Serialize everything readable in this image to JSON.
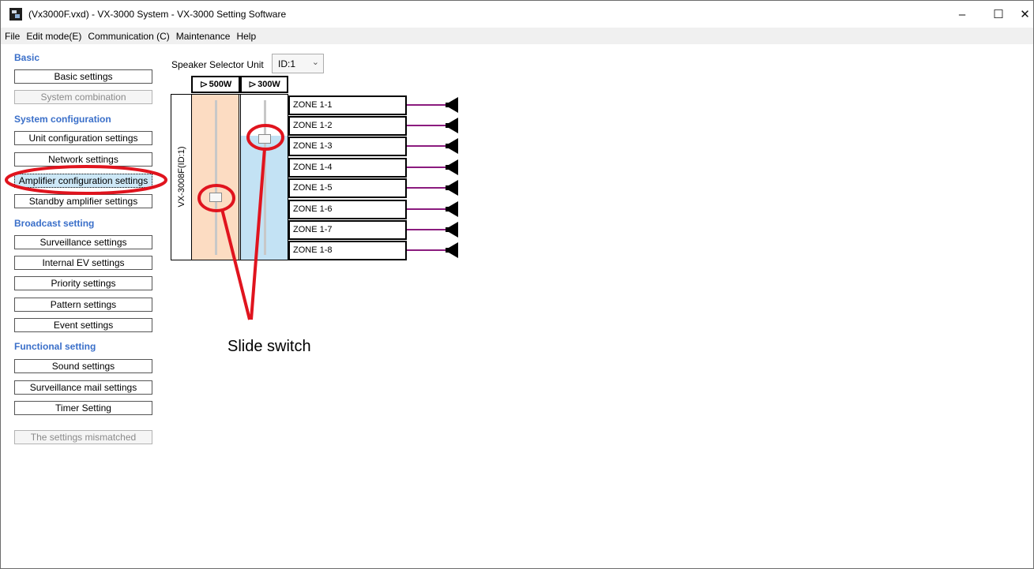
{
  "window": {
    "title": "(Vx3000F.vxd) - VX-3000 System - VX-3000 Setting Software",
    "controls": {
      "minimize": "–",
      "maximize": "☐",
      "close": "✕"
    }
  },
  "menubar": [
    "File",
    "Edit mode(E)",
    "Communication (C)",
    "Maintenance",
    "Help"
  ],
  "sidebar": {
    "categories": {
      "basic": "Basic",
      "system": "System configuration",
      "broadcast": "Broadcast setting",
      "functional": "Functional setting"
    },
    "buttons": {
      "basic_settings": "Basic settings",
      "system_combination": "System combination",
      "unit_configuration": "Unit configuration settings",
      "network": "Network settings",
      "amplifier_configuration": "Amplifier configuration settings",
      "standby_amplifier": "Standby amplifier settings",
      "surveillance": "Surveillance settings",
      "internal_ev": "Internal EV settings",
      "priority": "Priority settings",
      "pattern": "Pattern settings",
      "event": "Event settings",
      "sound": "Sound settings",
      "surveillance_mail": "Surveillance mail settings",
      "timer": "Timer Setting",
      "mismatched": "The settings mismatched"
    },
    "selected": "amplifier_configuration"
  },
  "speaker_selector": {
    "label": "Speaker Selector Unit",
    "selected": "ID:1",
    "chevron": "⌄"
  },
  "amplifiers": [
    {
      "label": "500W",
      "fill_color": "#fcdcc2",
      "icon": "amp-triangle-icon"
    },
    {
      "label": "300W",
      "fill_color": "#c3e2f4",
      "icon": "amp-triangle-icon"
    }
  ],
  "amp_symbol": "⊳",
  "unit_label": "VX-3008F(ID:1)",
  "zones": [
    "ZONE 1-1",
    "ZONE 1-2",
    "ZONE 1-3",
    "ZONE 1-4",
    "ZONE 1-5",
    "ZONE 1-6",
    "ZONE 1-7",
    "ZONE 1-8"
  ],
  "colors": {
    "wire": "#8b1b7e",
    "annotation": "#e0141e",
    "category": "#3a6fc9",
    "selected_bg": "#cde8f7"
  },
  "annotation": {
    "label": "Slide switch"
  }
}
